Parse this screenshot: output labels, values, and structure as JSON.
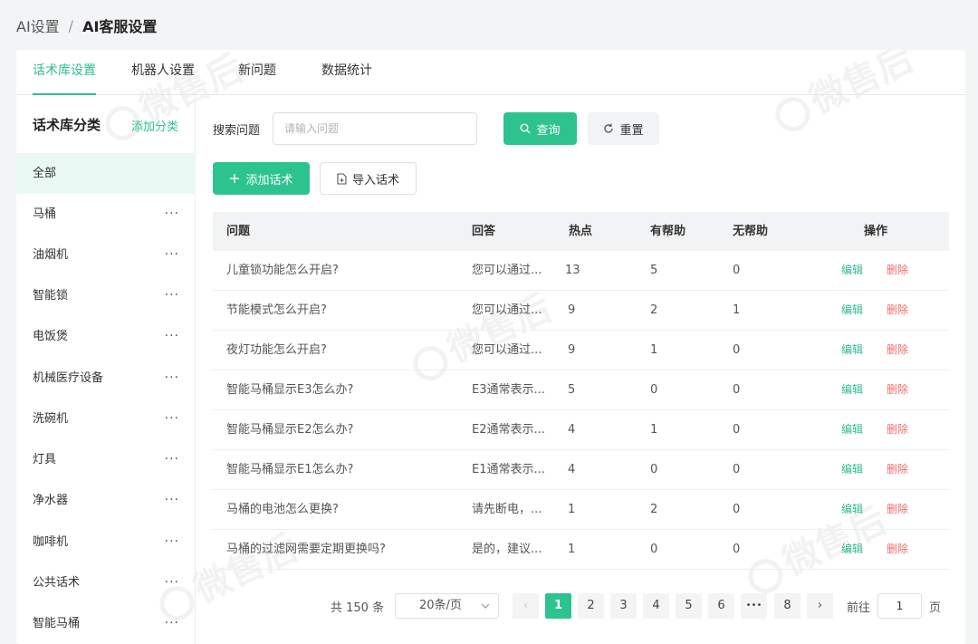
{
  "breadcrumb": {
    "parent": "AI设置",
    "separator": "/",
    "current": "AI客服设置"
  },
  "tabs": [
    {
      "label": "话术库设置",
      "active": true
    },
    {
      "label": "机器人设置",
      "active": false
    },
    {
      "label": "新问题",
      "active": false
    },
    {
      "label": "数据统计",
      "active": false
    }
  ],
  "sidebar": {
    "title": "话术库分类",
    "add_label": "添加分类",
    "more_glyph": "···",
    "items": [
      {
        "label": "全部"
      },
      {
        "label": "马桶"
      },
      {
        "label": "油烟机"
      },
      {
        "label": "智能锁"
      },
      {
        "label": "电饭煲"
      },
      {
        "label": "机械医疗设备"
      },
      {
        "label": "洗碗机"
      },
      {
        "label": "灯具"
      },
      {
        "label": "净水器"
      },
      {
        "label": "咖啡机"
      },
      {
        "label": "公共话术"
      },
      {
        "label": "智能马桶"
      }
    ]
  },
  "search": {
    "label": "搜索问题",
    "placeholder": "请输入问题",
    "value": "",
    "query_label": "查询",
    "reset_label": "重置"
  },
  "actions": {
    "add_label": "添加话术",
    "import_label": "导入话术"
  },
  "table": {
    "headers": {
      "question": "问题",
      "answer": "回答",
      "hot": "热点",
      "helpful": "有帮助",
      "unhelpful": "无帮助",
      "ops": "操作"
    },
    "edit_label": "编辑",
    "delete_label": "删除",
    "rows": [
      {
        "question": "儿童锁功能怎么开启?",
        "answer": "您可以通过...",
        "hot": "13",
        "helpful": "5",
        "unhelpful": "0"
      },
      {
        "question": "节能模式怎么开启?",
        "answer": "您可以通过...",
        "hot": "9",
        "helpful": "2",
        "unhelpful": "1"
      },
      {
        "question": "夜灯功能怎么开启?",
        "answer": "您可以通过...",
        "hot": "9",
        "helpful": "1",
        "unhelpful": "0"
      },
      {
        "question": "智能马桶显示E3怎么办?",
        "answer": "E3通常表示...",
        "hot": "5",
        "helpful": "0",
        "unhelpful": "0"
      },
      {
        "question": "智能马桶显示E2怎么办?",
        "answer": "E2通常表示...",
        "hot": "4",
        "helpful": "1",
        "unhelpful": "0"
      },
      {
        "question": "智能马桶显示E1怎么办?",
        "answer": "E1通常表示...",
        "hot": "4",
        "helpful": "0",
        "unhelpful": "0"
      },
      {
        "question": "马桶的电池怎么更换?",
        "answer": "请先断电，...",
        "hot": "1",
        "helpful": "2",
        "unhelpful": "0"
      },
      {
        "question": "马桶的过滤网需要定期更换吗?",
        "answer": "是的，建议...",
        "hot": "1",
        "helpful": "0",
        "unhelpful": "0"
      }
    ]
  },
  "pagination": {
    "total_text": "共 150 条",
    "page_size": "20条/页",
    "prev": "‹",
    "next": "›",
    "pages": [
      "1",
      "2",
      "3",
      "4",
      "5",
      "6",
      "•••",
      "8"
    ],
    "current_page": "1",
    "goto_label": "前往",
    "goto_value": "1",
    "goto_unit": "页"
  },
  "watermark_text": "微售后",
  "colors": {
    "accent": "#2dc38f",
    "danger": "#f56c6c",
    "active_bg": "#e9f8f2"
  }
}
